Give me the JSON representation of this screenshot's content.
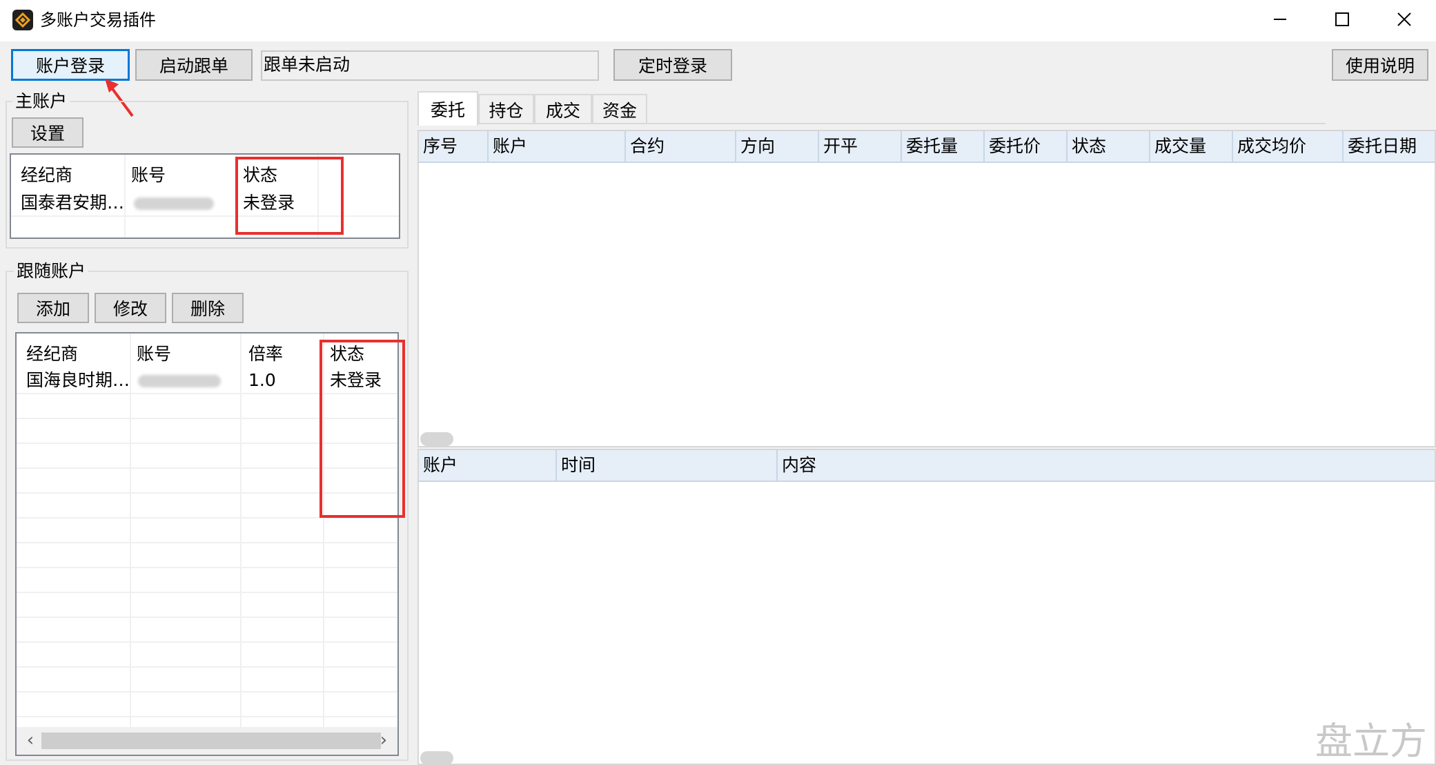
{
  "window": {
    "title": "多账户交易插件",
    "icon": "app-logo-icon"
  },
  "window_controls": {
    "minimize": "minimize-icon",
    "maximize": "maximize-icon",
    "close": "close-icon"
  },
  "toolbar": {
    "login_label": "账户登录",
    "start_follow_label": "启动跟单",
    "follow_status": "跟单未启动",
    "timed_login_label": "定时登录",
    "help_label": "使用说明"
  },
  "main_account": {
    "group_label": "主账户",
    "settings_label": "设置",
    "columns": [
      "经纪商",
      "账号",
      "状态"
    ],
    "rows": [
      {
        "broker": "国泰君安期…",
        "account": "",
        "status": "未登录"
      }
    ]
  },
  "follow_accounts": {
    "group_label": "跟随账户",
    "add_label": "添加",
    "edit_label": "修改",
    "delete_label": "删除",
    "columns": [
      "经纪商",
      "账号",
      "倍率",
      "状态"
    ],
    "rows": [
      {
        "broker": "国海良时期…",
        "account": "",
        "ratio": "1.0",
        "status": "未登录"
      }
    ],
    "scroll_left": "‹",
    "scroll_right": "›"
  },
  "tabs": [
    {
      "label": "委托",
      "active": true
    },
    {
      "label": "持仓",
      "active": false
    },
    {
      "label": "成交",
      "active": false
    },
    {
      "label": "资金",
      "active": false
    }
  ],
  "orders_table": {
    "columns": [
      "序号",
      "账户",
      "合约",
      "方向",
      "开平",
      "委托量",
      "委托价",
      "状态",
      "成交量",
      "成交均价",
      "委托日期"
    ]
  },
  "log_table": {
    "columns": [
      "账户",
      "时间",
      "内容"
    ]
  },
  "watermark": "盘立方",
  "colors": {
    "accent": "#0078d7",
    "highlight": "#e8302e",
    "header_bg": "#e6eef8"
  }
}
